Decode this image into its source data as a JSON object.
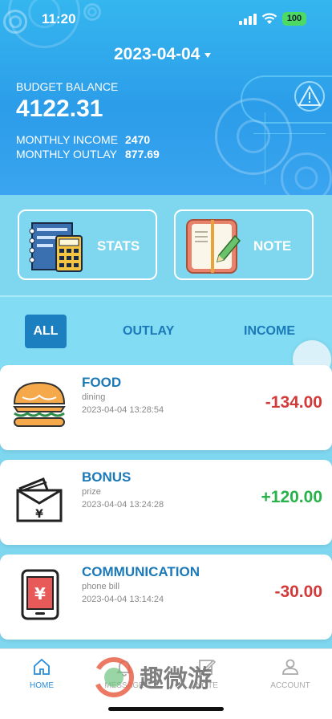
{
  "status_bar": {
    "time": "11:20",
    "battery": "100"
  },
  "header": {
    "date": "2023-04-04",
    "budget_balance_label": "BUDGET BALANCE",
    "budget_balance_value": "4122.31",
    "monthly_income_label": "MONTHLY INCOME",
    "monthly_income_value": "2470",
    "monthly_outlay_label": "MONTHLY OUTLAY",
    "monthly_outlay_value": "877.69"
  },
  "quick_actions": {
    "stats_label": "STATS",
    "note_label": "NOTE"
  },
  "filter_tabs": {
    "all": "ALL",
    "outlay": "OUTLAY",
    "income": "INCOME",
    "active": "ALL"
  },
  "transactions": [
    {
      "title": "FOOD",
      "category": "dining",
      "time": "2023-04-04 13:28:54",
      "amount": "-134.00",
      "icon": "burger-icon"
    },
    {
      "title": "BONUS",
      "category": "prize",
      "time": "2023-04-04 13:24:28",
      "amount": "+120.00",
      "icon": "money-envelope-icon"
    },
    {
      "title": "COMMUNICATION",
      "category": "phone bill",
      "time": "2023-04-04 13:14:24",
      "amount": "-30.00",
      "icon": "phone-bill-icon"
    }
  ],
  "bottom_nav": {
    "home": "HOME",
    "message": "MESSAGE",
    "note": "NOTE",
    "account": "ACCOUNT",
    "active": "HOME"
  },
  "watermark": "趣微游",
  "colors": {
    "accent": "#1b7fc0",
    "positive": "#27b24a",
    "negative": "#d23a3a",
    "header": "#2c9de9"
  }
}
